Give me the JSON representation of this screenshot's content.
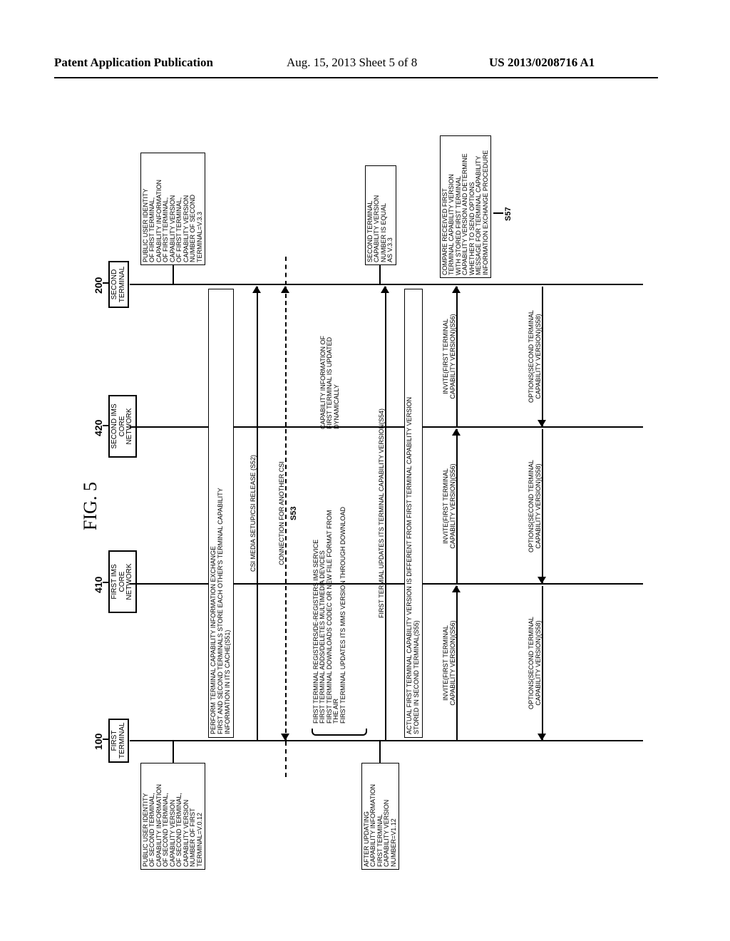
{
  "header": {
    "left": "Patent Application Publication",
    "center": "Aug. 15, 2013  Sheet 5 of 8",
    "right": "US 2013/0208716 A1"
  },
  "figure": {
    "title": "FIG. 5",
    "refs": {
      "first": "100",
      "firstNet": "410",
      "secondNet": "420",
      "second": "200"
    },
    "lifelines": {
      "first": "FIRST\nTERMINAL",
      "firstNet": "FIRST IMS CORE\nNETWORK",
      "secondNet": "SECOND IMS\nCORE NETWORK",
      "second": "SECOND\nTERMINAL"
    },
    "noteL1": "PUBLIC USER IDENTITY\nOF SECOND TERMINAL,\nCAPABILITY INFORMATION\nOF SECOND TERMINAL,\nCAPABILITY VERSION\nOF SECOND TERMINAL,\nCAPABILITY VERSION\nNUMBER OF FIRST\nTERMINAL=V.0.12",
    "noteR1": "PUBLIC USER IDENTITY\nOF FIRST TERMINAL,\nCAPABILITY INFORMATION\nOF FIRST TERMINAL,\nCAPABILITY VERSION\nOF FIRST TERMINAL,\nCAPABILITY VERSION\nNUMBER OF SECOND\nTERMINAL=V.3.3",
    "band1": "PERFORM TERMINAL CAPABILITY INFORMATION EXCHANGE\nFIRST AND SECOND TERMINALS STORE EACH OTHER'S TERMINAL CAPABILITY\nINFORMATION IN ITS CACHE(S51)",
    "msg52": "CSI MEDIA SETUP/CSI RELEASE (S52)",
    "msg53a": "CONNECTION FOR ANOTHER CSI",
    "s53": "S53",
    "dyn": "FIRST TERMINAL REGISTERS/DE-REGISTERS IMS SERVICE\nFIRST TERMINAL ADDS/DELETES MULTIMEDIA DEVICES\nFIRST TERMINAL DOWNLOADS CODEC OR NEW FILE FORMAT FROM\nTHE AIR\nFIRST TERMINAL UPDATES ITS MMS VERSION THROUGH DOWNLOAD",
    "dynR": "CAPABILITY INFORMATION OF\nFIRST TERMINAL IS UPDATED\nDYNAMICALLY",
    "noteL2": "AFTER UPDATING\nCAPABILITY INFORMATION\nFIRST TERMINAL\nCAPABILITY VERSION\nNUMBER=V1.12",
    "noteRv33": "SECOND TERMINAL\nCAPABILITY VERSION\nNUMBER IS EQUAL\nAS V.3.3",
    "msg54": "FIRST TERMIAL UPDATES ITS TERMINAL CAPABILITY VERSION(S54)",
    "band55": "ACTUAL FIRST TERMINAL CAPABILITY VERSION IS DIFFERENT FROM FIRST TERMINAL CAPABILITY VERSION\nSTORED IN SECOND TERMINAL(S55)",
    "msg56": "INVITE(FIRST TERMINAL\nCAPABILITY VERSION)(S56)",
    "noteR57": "COMPARE RECEIVED FIRST\nTERMINAL CAPABILITY VERSION\nWITH STORED FIRST TERMINAL\nCAPABILITY VERSION AND DETERMINE\nWHETHER TO SEND OPTIONS\nMESSAGE FOR TERMINAL CAPABILITY\nINFORMATION EXCHANGE PROCEDURE",
    "s57": "S57",
    "msg58": "OPTIONS(SECOND TERMINAL\nCAPABILITY VERSION)(S58)"
  }
}
